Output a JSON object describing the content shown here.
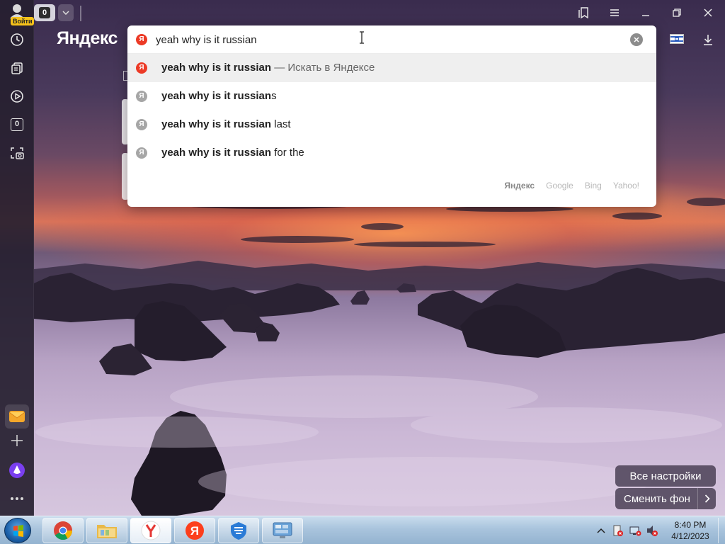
{
  "sidebar": {
    "login_label": "Войти",
    "items": [
      {
        "name": "history-icon"
      },
      {
        "name": "collections-icon"
      },
      {
        "name": "video-icon"
      },
      {
        "name": "tabs-counter-icon",
        "label": "0"
      },
      {
        "name": "screenshot-icon"
      }
    ],
    "bottom": [
      {
        "name": "mail-icon"
      },
      {
        "name": "add-icon"
      },
      {
        "name": "alice-icon"
      },
      {
        "name": "more-icon"
      }
    ]
  },
  "topbar": {
    "tab_count": "0",
    "brand": "Яндекс"
  },
  "omnibox": {
    "query": "yeah why is it russian",
    "suggestions": [
      {
        "bold": "yeah why is it russian",
        "rest": " — Искать в Яндексе",
        "type": "search"
      },
      {
        "bold": "yeah why is it russian",
        "rest": "s",
        "type": "suggest"
      },
      {
        "bold": "yeah why is it russian",
        "rest": " last",
        "type": "suggest"
      },
      {
        "bold": "yeah why is it russian",
        "rest": " for the",
        "type": "suggest"
      }
    ],
    "engines": [
      "Яндекс",
      "Google",
      "Bing",
      "Yahoo!"
    ],
    "logo_letter": "Я"
  },
  "background_controls": {
    "settings_label": "Все настройки",
    "change_bg_label": "Сменить фон"
  },
  "taskbar": {
    "time": "8:40 PM",
    "date": "4/12/2023",
    "apps": [
      "chrome",
      "explorer",
      "yandex-browser",
      "yandex",
      "defender",
      "control-panel"
    ]
  },
  "colors": {
    "accent_red": "#ec3a26",
    "taskbar": "#a9c4dd"
  }
}
